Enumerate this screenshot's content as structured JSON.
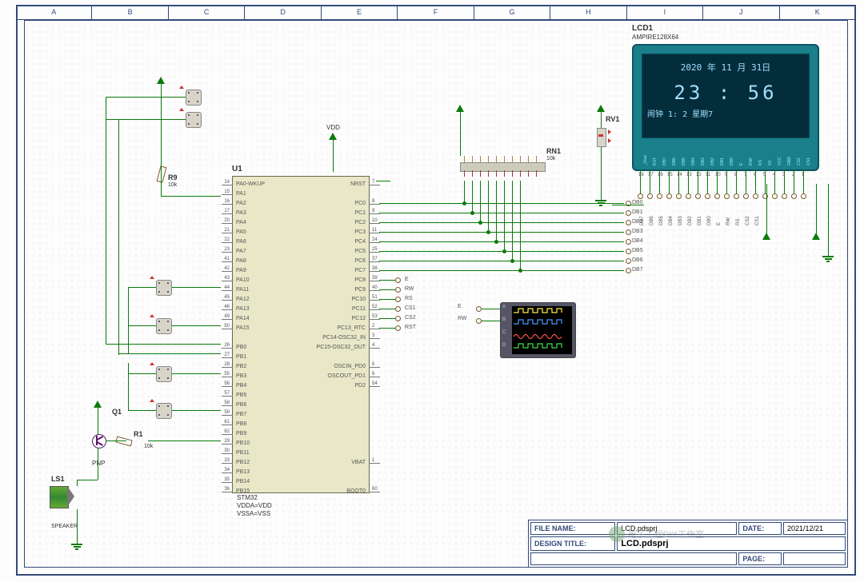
{
  "ruler_cols": [
    "A",
    "B",
    "C",
    "D",
    "E",
    "F",
    "G",
    "H",
    "I",
    "J",
    "K"
  ],
  "u1": {
    "ref": "U1",
    "part": "STM32",
    "notes1": "VDDA=VDD",
    "notes2": "VSSA=VSS",
    "left_pins": [
      {
        "n": "14",
        "l": "PA0-WKUP"
      },
      {
        "n": "15",
        "l": "PA1"
      },
      {
        "n": "16",
        "l": "PA2"
      },
      {
        "n": "17",
        "l": "PA3"
      },
      {
        "n": "20",
        "l": "PA4"
      },
      {
        "n": "21",
        "l": "PA5"
      },
      {
        "n": "22",
        "l": "PA6"
      },
      {
        "n": "23",
        "l": "PA7"
      },
      {
        "n": "41",
        "l": "PA8"
      },
      {
        "n": "42",
        "l": "PA9"
      },
      {
        "n": "43",
        "l": "PA10"
      },
      {
        "n": "44",
        "l": "PA11"
      },
      {
        "n": "45",
        "l": "PA12"
      },
      {
        "n": "46",
        "l": "PA13"
      },
      {
        "n": "49",
        "l": "PA14"
      },
      {
        "n": "50",
        "l": "PA15"
      },
      {
        "n": "",
        "l": ""
      },
      {
        "n": "26",
        "l": "PB0"
      },
      {
        "n": "27",
        "l": "PB1"
      },
      {
        "n": "28",
        "l": "PB2"
      },
      {
        "n": "55",
        "l": "PB3"
      },
      {
        "n": "56",
        "l": "PB4"
      },
      {
        "n": "57",
        "l": "PB5"
      },
      {
        "n": "58",
        "l": "PB6"
      },
      {
        "n": "59",
        "l": "PB7"
      },
      {
        "n": "61",
        "l": "PB8"
      },
      {
        "n": "62",
        "l": "PB9"
      },
      {
        "n": "29",
        "l": "PB10"
      },
      {
        "n": "30",
        "l": "PB11"
      },
      {
        "n": "33",
        "l": "PB12"
      },
      {
        "n": "34",
        "l": "PB13"
      },
      {
        "n": "35",
        "l": "PB14"
      },
      {
        "n": "36",
        "l": "PB15"
      }
    ],
    "right_pins": [
      {
        "n": "7",
        "l": "NRST"
      },
      {
        "n": "",
        "l": ""
      },
      {
        "n": "8",
        "l": "PC0"
      },
      {
        "n": "9",
        "l": "PC1"
      },
      {
        "n": "10",
        "l": "PC2"
      },
      {
        "n": "11",
        "l": "PC3"
      },
      {
        "n": "24",
        "l": "PC4"
      },
      {
        "n": "25",
        "l": "PC5"
      },
      {
        "n": "37",
        "l": "PC6"
      },
      {
        "n": "38",
        "l": "PC7"
      },
      {
        "n": "39",
        "l": "PC8"
      },
      {
        "n": "40",
        "l": "PC9"
      },
      {
        "n": "51",
        "l": "PC10"
      },
      {
        "n": "52",
        "l": "PC11"
      },
      {
        "n": "53",
        "l": "PC12"
      },
      {
        "n": "2",
        "l": "PC13_RTC"
      },
      {
        "n": "3",
        "l": "PC14-OSC32_IN"
      },
      {
        "n": "4",
        "l": "PC15-OSC32_OUT"
      },
      {
        "n": "",
        "l": ""
      },
      {
        "n": "5",
        "l": "OSCIN_PD0"
      },
      {
        "n": "6",
        "l": "OSCOUT_PD1"
      },
      {
        "n": "54",
        "l": "PD2"
      },
      {
        "n": "",
        "l": ""
      },
      {
        "n": "",
        "l": ""
      },
      {
        "n": "",
        "l": ""
      },
      {
        "n": "",
        "l": ""
      },
      {
        "n": "",
        "l": ""
      },
      {
        "n": "",
        "l": ""
      },
      {
        "n": "",
        "l": ""
      },
      {
        "n": "1",
        "l": "VBAT"
      },
      {
        "n": "",
        "l": ""
      },
      {
        "n": "",
        "l": ""
      },
      {
        "n": "60",
        "l": "BOOT0"
      }
    ]
  },
  "lcd": {
    "ref": "LCD1",
    "part": "AMPIRE128X64",
    "line1": "2020 年 11 月 31日",
    "line2": "23 : 56",
    "line3": "闹钟 1: 2    星期7",
    "internal_pins": [
      "_Vout",
      "RST",
      "DB7",
      "DB6",
      "DB5",
      "DB4",
      "DB3",
      "DB2",
      "DB1",
      "DB0",
      "E",
      "R/W",
      "RS",
      "V0",
      "VCC",
      "GND",
      "CS2",
      "CS1"
    ],
    "external_pins": [
      "DB7",
      "DB6",
      "DB5",
      "DB4",
      "DB3",
      "DB2",
      "DB1",
      "DB0",
      "E",
      "RW",
      "RS",
      "CS2",
      "CS1"
    ]
  },
  "rn1": {
    "ref": "RN1",
    "val": "10k"
  },
  "rv1": {
    "ref": "RV1"
  },
  "r9": {
    "ref": "R9",
    "val": "10k"
  },
  "r1": {
    "ref": "R1",
    "val": "10k"
  },
  "q1": {
    "ref": "Q1",
    "type": "PNP"
  },
  "ls1": {
    "ref": "LS1",
    "val": "SPEAKER"
  },
  "vdd_label": "VDD",
  "net_labels": {
    "db": [
      "DB0",
      "DB1",
      "DB2",
      "DB3",
      "DB4",
      "DB5",
      "DB6",
      "DB7"
    ],
    "ctrl": [
      "E",
      "RW",
      "RS",
      "CS1",
      "CS2",
      "RST"
    ]
  },
  "scope": {
    "chans": [
      "A",
      "B",
      "C",
      "D"
    ],
    "sig": [
      "E",
      "RW"
    ]
  },
  "title_block": {
    "file_label": "FILE NAME:",
    "file_val": "LCD.pdsprj",
    "date_label": "DATE:",
    "date_val": "2021/12/21",
    "design_label": "DESIGN TITLE:",
    "design_val": "LCD.pdsprj",
    "page_label": "PAGE:"
  },
  "watermark": "电子工程DIY工作室"
}
